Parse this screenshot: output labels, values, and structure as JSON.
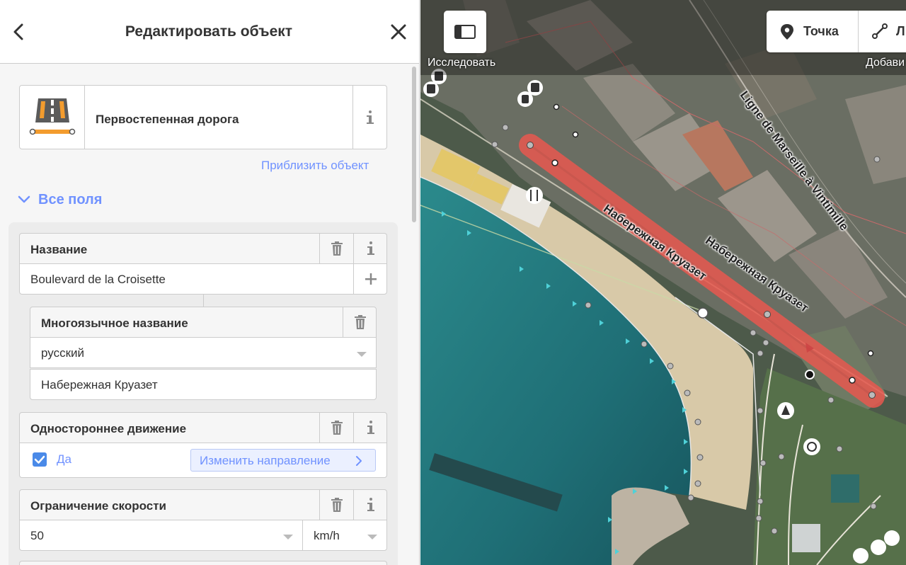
{
  "header": {
    "title": "Редактировать объект"
  },
  "preset": {
    "name": "Первостепенная дорога",
    "icon": "primary-road-icon"
  },
  "zoom_link": "Приблизить объект",
  "all_fields": "Все поля",
  "fields": {
    "name": {
      "label": "Название",
      "value": "Boulevard de la Croisette"
    },
    "multilingual": {
      "label": "Многоязычное название",
      "language": "русский",
      "value": "Набережная Круазет"
    },
    "oneway": {
      "label": "Одностороннее движение",
      "checkbox_label": "Да",
      "checked": true,
      "reverse_button": "Изменить направление"
    },
    "maxspeed": {
      "label": "Ограничение скорости",
      "value": "50",
      "unit": "km/h"
    }
  },
  "map": {
    "explore_label": "Исследовать",
    "mode_point": "Точка",
    "mode_line": "Л",
    "add_label": "Добави",
    "labels": {
      "road_main": "Набережная Круазет",
      "road_secondary": "Набережная Круазет",
      "railway": "Ligne de Marseille à Vintimille"
    }
  },
  "colors": {
    "accent": "#7092ff",
    "selection": "#e8584f",
    "sea": "#1f6f76",
    "beach": "#d8c9a8"
  }
}
